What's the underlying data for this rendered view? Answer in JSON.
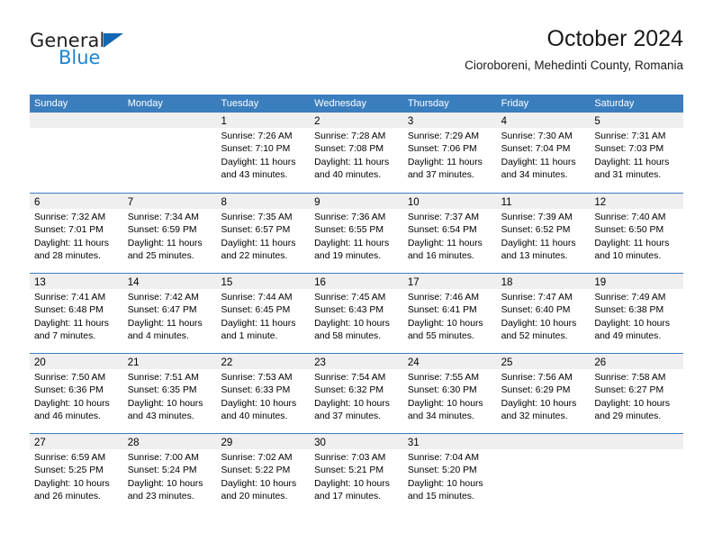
{
  "brand": {
    "name_part1": "General",
    "name_part2": "Blue",
    "triangle_color": "#1268b3",
    "blue_color": "#1d84d2"
  },
  "header": {
    "month_title": "October 2024",
    "location": "Cioroboreni, Mehedinti County, Romania"
  },
  "colors": {
    "header_blue": "#3b7ebe",
    "day_band_gray": "#efefef",
    "text": "#000000"
  },
  "calendar": {
    "weekday_headers": [
      "Sunday",
      "Monday",
      "Tuesday",
      "Wednesday",
      "Thursday",
      "Friday",
      "Saturday"
    ],
    "weeks": [
      [
        {
          "day": "",
          "lines": []
        },
        {
          "day": "",
          "lines": []
        },
        {
          "day": "1",
          "lines": [
            "Sunrise: 7:26 AM",
            "Sunset: 7:10 PM",
            "Daylight: 11 hours",
            "and 43 minutes."
          ]
        },
        {
          "day": "2",
          "lines": [
            "Sunrise: 7:28 AM",
            "Sunset: 7:08 PM",
            "Daylight: 11 hours",
            "and 40 minutes."
          ]
        },
        {
          "day": "3",
          "lines": [
            "Sunrise: 7:29 AM",
            "Sunset: 7:06 PM",
            "Daylight: 11 hours",
            "and 37 minutes."
          ]
        },
        {
          "day": "4",
          "lines": [
            "Sunrise: 7:30 AM",
            "Sunset: 7:04 PM",
            "Daylight: 11 hours",
            "and 34 minutes."
          ]
        },
        {
          "day": "5",
          "lines": [
            "Sunrise: 7:31 AM",
            "Sunset: 7:03 PM",
            "Daylight: 11 hours",
            "and 31 minutes."
          ]
        }
      ],
      [
        {
          "day": "6",
          "lines": [
            "Sunrise: 7:32 AM",
            "Sunset: 7:01 PM",
            "Daylight: 11 hours",
            "and 28 minutes."
          ]
        },
        {
          "day": "7",
          "lines": [
            "Sunrise: 7:34 AM",
            "Sunset: 6:59 PM",
            "Daylight: 11 hours",
            "and 25 minutes."
          ]
        },
        {
          "day": "8",
          "lines": [
            "Sunrise: 7:35 AM",
            "Sunset: 6:57 PM",
            "Daylight: 11 hours",
            "and 22 minutes."
          ]
        },
        {
          "day": "9",
          "lines": [
            "Sunrise: 7:36 AM",
            "Sunset: 6:55 PM",
            "Daylight: 11 hours",
            "and 19 minutes."
          ]
        },
        {
          "day": "10",
          "lines": [
            "Sunrise: 7:37 AM",
            "Sunset: 6:54 PM",
            "Daylight: 11 hours",
            "and 16 minutes."
          ]
        },
        {
          "day": "11",
          "lines": [
            "Sunrise: 7:39 AM",
            "Sunset: 6:52 PM",
            "Daylight: 11 hours",
            "and 13 minutes."
          ]
        },
        {
          "day": "12",
          "lines": [
            "Sunrise: 7:40 AM",
            "Sunset: 6:50 PM",
            "Daylight: 11 hours",
            "and 10 minutes."
          ]
        }
      ],
      [
        {
          "day": "13",
          "lines": [
            "Sunrise: 7:41 AM",
            "Sunset: 6:48 PM",
            "Daylight: 11 hours",
            "and 7 minutes."
          ]
        },
        {
          "day": "14",
          "lines": [
            "Sunrise: 7:42 AM",
            "Sunset: 6:47 PM",
            "Daylight: 11 hours",
            "and 4 minutes."
          ]
        },
        {
          "day": "15",
          "lines": [
            "Sunrise: 7:44 AM",
            "Sunset: 6:45 PM",
            "Daylight: 11 hours",
            "and 1 minute."
          ]
        },
        {
          "day": "16",
          "lines": [
            "Sunrise: 7:45 AM",
            "Sunset: 6:43 PM",
            "Daylight: 10 hours",
            "and 58 minutes."
          ]
        },
        {
          "day": "17",
          "lines": [
            "Sunrise: 7:46 AM",
            "Sunset: 6:41 PM",
            "Daylight: 10 hours",
            "and 55 minutes."
          ]
        },
        {
          "day": "18",
          "lines": [
            "Sunrise: 7:47 AM",
            "Sunset: 6:40 PM",
            "Daylight: 10 hours",
            "and 52 minutes."
          ]
        },
        {
          "day": "19",
          "lines": [
            "Sunrise: 7:49 AM",
            "Sunset: 6:38 PM",
            "Daylight: 10 hours",
            "and 49 minutes."
          ]
        }
      ],
      [
        {
          "day": "20",
          "lines": [
            "Sunrise: 7:50 AM",
            "Sunset: 6:36 PM",
            "Daylight: 10 hours",
            "and 46 minutes."
          ]
        },
        {
          "day": "21",
          "lines": [
            "Sunrise: 7:51 AM",
            "Sunset: 6:35 PM",
            "Daylight: 10 hours",
            "and 43 minutes."
          ]
        },
        {
          "day": "22",
          "lines": [
            "Sunrise: 7:53 AM",
            "Sunset: 6:33 PM",
            "Daylight: 10 hours",
            "and 40 minutes."
          ]
        },
        {
          "day": "23",
          "lines": [
            "Sunrise: 7:54 AM",
            "Sunset: 6:32 PM",
            "Daylight: 10 hours",
            "and 37 minutes."
          ]
        },
        {
          "day": "24",
          "lines": [
            "Sunrise: 7:55 AM",
            "Sunset: 6:30 PM",
            "Daylight: 10 hours",
            "and 34 minutes."
          ]
        },
        {
          "day": "25",
          "lines": [
            "Sunrise: 7:56 AM",
            "Sunset: 6:29 PM",
            "Daylight: 10 hours",
            "and 32 minutes."
          ]
        },
        {
          "day": "26",
          "lines": [
            "Sunrise: 7:58 AM",
            "Sunset: 6:27 PM",
            "Daylight: 10 hours",
            "and 29 minutes."
          ]
        }
      ],
      [
        {
          "day": "27",
          "lines": [
            "Sunrise: 6:59 AM",
            "Sunset: 5:25 PM",
            "Daylight: 10 hours",
            "and 26 minutes."
          ]
        },
        {
          "day": "28",
          "lines": [
            "Sunrise: 7:00 AM",
            "Sunset: 5:24 PM",
            "Daylight: 10 hours",
            "and 23 minutes."
          ]
        },
        {
          "day": "29",
          "lines": [
            "Sunrise: 7:02 AM",
            "Sunset: 5:22 PM",
            "Daylight: 10 hours",
            "and 20 minutes."
          ]
        },
        {
          "day": "30",
          "lines": [
            "Sunrise: 7:03 AM",
            "Sunset: 5:21 PM",
            "Daylight: 10 hours",
            "and 17 minutes."
          ]
        },
        {
          "day": "31",
          "lines": [
            "Sunrise: 7:04 AM",
            "Sunset: 5:20 PM",
            "Daylight: 10 hours",
            "and 15 minutes."
          ]
        },
        {
          "day": "",
          "lines": []
        },
        {
          "day": "",
          "lines": []
        }
      ]
    ]
  }
}
